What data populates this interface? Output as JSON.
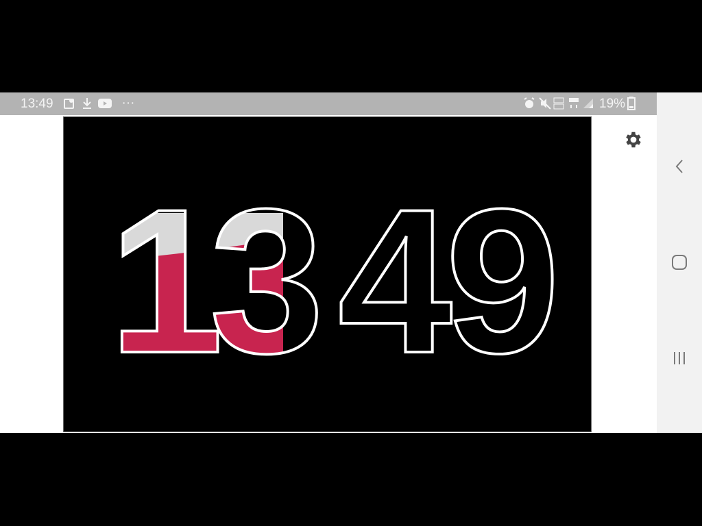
{
  "status_bar": {
    "time": "13:49",
    "more": "···",
    "battery_percent": "19%",
    "left_icons": [
      "map-pin-icon",
      "download-icon",
      "youtube-icon"
    ],
    "right_icons": [
      "alarm-icon",
      "mute-icon",
      "volte-icon",
      "4g-icon",
      "signal-icon",
      "battery-icon"
    ]
  },
  "clock": {
    "hours": "13",
    "minutes": "49",
    "digit_outline_color": "#ffffff",
    "fill_color": "#c8244f",
    "fill_level_hours": 0.85,
    "background": "#000000"
  },
  "settings": {
    "icon": "gear-icon"
  },
  "navigation": {
    "buttons": [
      "back-icon",
      "home-icon",
      "recents-icon"
    ]
  }
}
